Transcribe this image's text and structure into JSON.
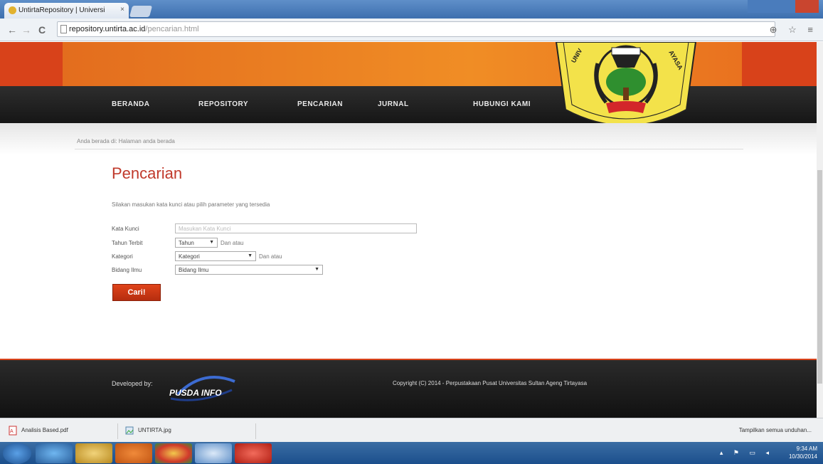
{
  "browser": {
    "tab_title": "UntirtaRepository | Universi",
    "tab_close": "×",
    "url_host": "repository.untirta.ac.id",
    "url_path": "/pencarian.html",
    "back": "←",
    "forward": "→",
    "reload": "C",
    "toolbar_icons": "⊕ ☆ ≡"
  },
  "nav": {
    "items": [
      "BERANDA",
      "REPOSITORY",
      "PENCARIAN",
      "JURNAL",
      "HUBUNGI KAMI"
    ]
  },
  "breadcrumb": "Anda berada di: Halaman anda berada",
  "main": {
    "title": "Pencarian",
    "description": "Silakan masukan kata kunci atau pilih parameter yang tersedia",
    "form": {
      "kata_kunci_label": "Kata Kunci",
      "kata_kunci_placeholder": "Masukan Kata Kunci",
      "tahun_label": "Tahun Terbit",
      "tahun_value": "Tahun",
      "tahun_after": "Dan atau",
      "kategori_label": "Kategori",
      "kategori_value": "Kategori",
      "kategori_after": "Dan atau",
      "bidang_label": "Bidang Ilmu",
      "bidang_value": "Bidang Ilmu",
      "submit_label": "Cari!"
    }
  },
  "footer": {
    "developed_by": "Developed by:",
    "developer_logo": "PUSDA INFO",
    "copyright": "Copyright (C) 2014 - Perpustakaan Pusat Universitas Sultan Ageng Tirtayasa"
  },
  "downloads": {
    "items": [
      {
        "name": "Analisis Based.pdf",
        "icon": "pdf-icon"
      },
      {
        "name": "UNTIRTA.jpg",
        "icon": "image-file-icon"
      }
    ],
    "show_all": "Tampilkan semua unduhan..."
  },
  "taskbar": {
    "time": "9:34 AM",
    "date": "10/30/2014"
  },
  "colors": {
    "accent": "#d8421a",
    "title_red": "#c0392b",
    "menubar": "#1e1e1e"
  }
}
